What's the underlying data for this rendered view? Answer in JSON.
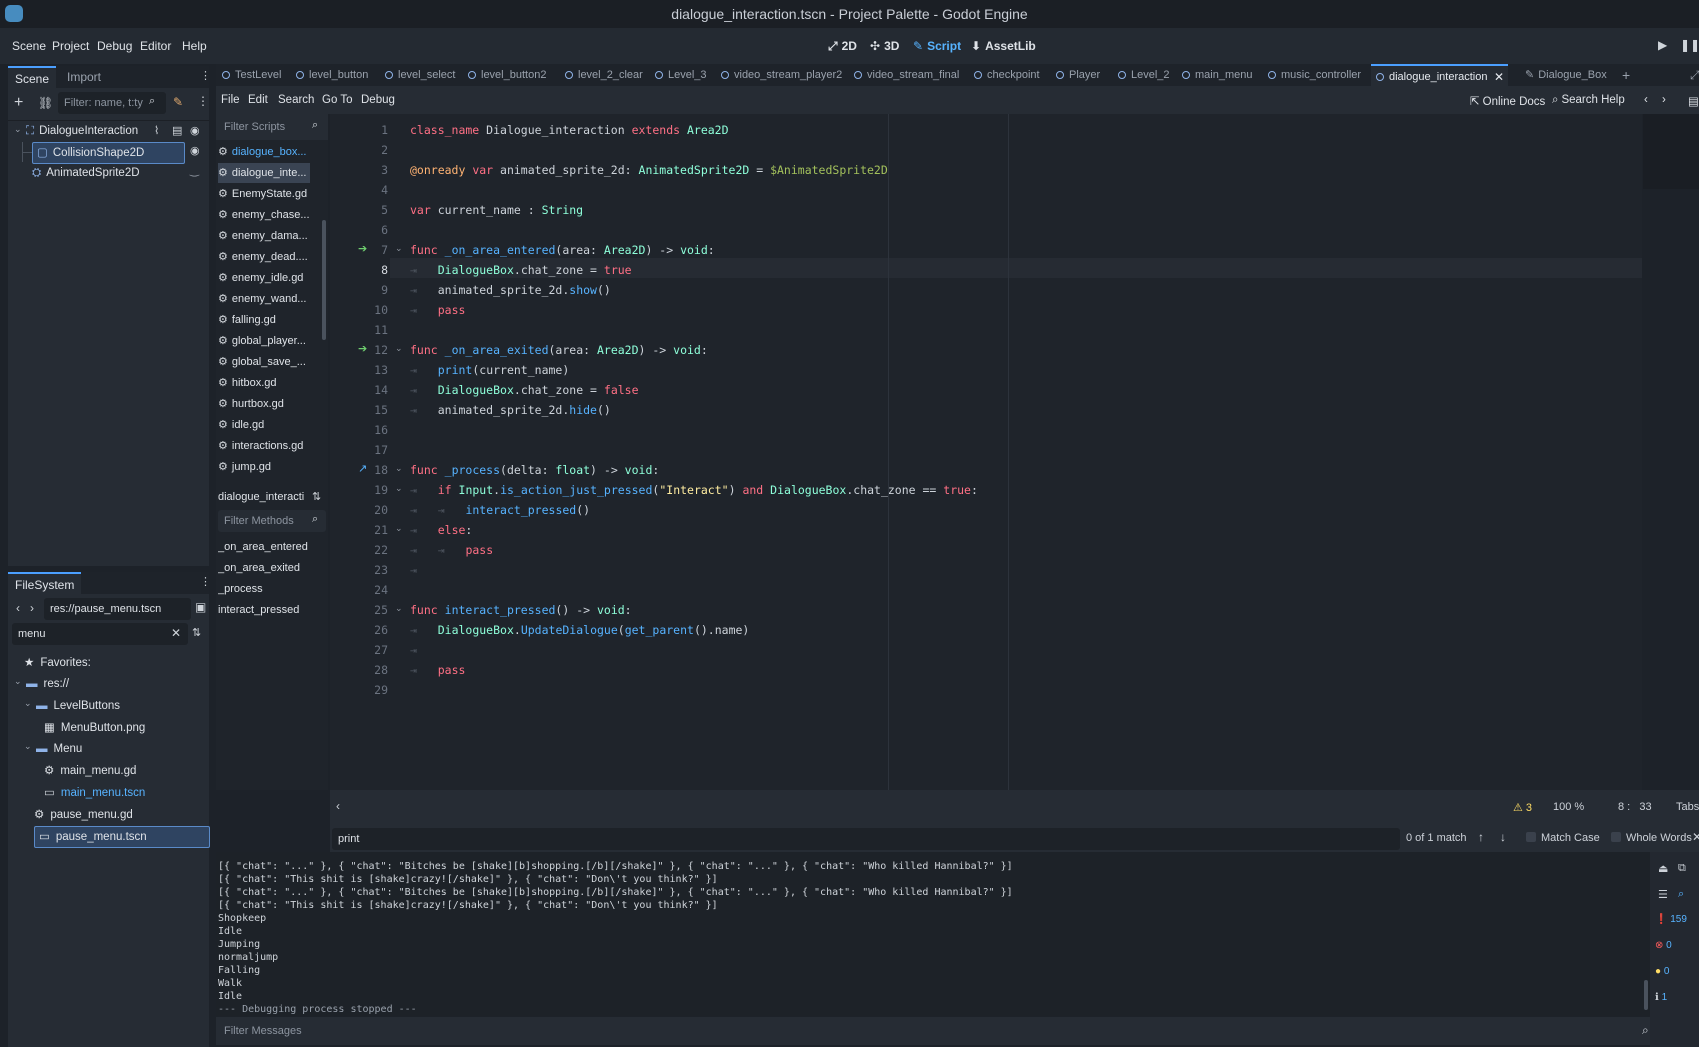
{
  "window": {
    "title": "dialogue_interaction.tscn - Project Palette - Godot Engine"
  },
  "menu": {
    "items": [
      "Scene",
      "Project",
      "Debug",
      "Editor",
      "Help"
    ]
  },
  "workspaces": [
    {
      "icon": "⤢",
      "label": "2D"
    },
    {
      "icon": "✣",
      "label": "3D"
    },
    {
      "icon": "✎",
      "label": "Script"
    },
    {
      "icon": "⬇",
      "label": "AssetLib"
    }
  ],
  "scene_dock": {
    "tabs": [
      "Scene",
      "Import"
    ],
    "filter_placeholder": "Filter: name, t:ty",
    "nodes": [
      "DialogueInteraction",
      "CollisionShape2D",
      "AnimatedSprite2D"
    ]
  },
  "filesystem_dock": {
    "tab": "FileSystem",
    "path": "res://pause_menu.tscn",
    "search": "menu",
    "items": [
      "Favorites:",
      "res://",
      "LevelButtons",
      "MenuButton.png",
      "Menu",
      "main_menu.gd",
      "main_menu.tscn",
      "pause_menu.gd",
      "pause_menu.tscn"
    ]
  },
  "editor_tabs": [
    "TestLevel",
    "level_button",
    "level_select",
    "level_button2",
    "level_2_clear",
    "Level_3",
    "video_stream_player2",
    "video_stream_final",
    "checkpoint",
    "Player",
    "Level_2",
    "main_menu",
    "music_controller",
    "dialogue_interaction",
    "Dialogue_Box"
  ],
  "script_menu": [
    "File",
    "Edit",
    "Search",
    "Go To",
    "Debug"
  ],
  "script_toolbar_right": {
    "online_docs": "Online Docs",
    "search_help": "Search Help"
  },
  "scripts_panel": {
    "filter_placeholder": "Filter Scripts",
    "scripts": [
      "dialogue_box...",
      "dialogue_inte...",
      "EnemyState.gd",
      "enemy_chase...",
      "enemy_dama...",
      "enemy_dead....",
      "enemy_idle.gd",
      "enemy_wand...",
      "falling.gd",
      "global_player...",
      "global_save_...",
      "hitbox.gd",
      "hurtbox.gd",
      "idle.gd",
      "interactions.gd",
      "jump.gd"
    ],
    "current_script": "dialogue_interacti",
    "methods_placeholder": "Filter Methods",
    "methods": [
      "_on_area_entered",
      "_on_area_exited",
      "_process",
      "interact_pressed"
    ]
  },
  "code": {
    "line_numbers": [
      "1",
      "2",
      "3",
      "4",
      "5",
      "6",
      "7",
      "8",
      "9",
      "10",
      "11",
      "12",
      "13",
      "14",
      "15",
      "16",
      "17",
      "18",
      "19",
      "20",
      "21",
      "22",
      "23",
      "24",
      "25",
      "26",
      "27",
      "28",
      "29"
    ],
    "current_line": 8
  },
  "status": {
    "warnings": "3",
    "zoom": "100 %",
    "cursor": "8 :   33",
    "indent": "Tabs"
  },
  "find": {
    "query": "print",
    "matches": "0 of 1 match",
    "match_case": "Match Case",
    "whole_words": "Whole Words"
  },
  "output": {
    "lines": [
      "[{ \"chat\": \"...\" }, { \"chat\": \"Bitches be [shake][b]shopping.[/b][/shake]\" }, { \"chat\": \"...\" }, { \"chat\": \"Who killed Hannibal?\" }]",
      "[{ \"chat\": \"This shit is [shake]crazy![/shake]\" }, { \"chat\": \"Don\\'t you think?\" }]",
      "[{ \"chat\": \"...\" }, { \"chat\": \"Bitches be [shake][b]shopping.[/b][/shake]\" }, { \"chat\": \"...\" }, { \"chat\": \"Who killed Hannibal?\" }]",
      "[{ \"chat\": \"This shit is [shake]crazy![/shake]\" }, { \"chat\": \"Don\\'t you think?\" }]",
      "Shopkeep",
      "Idle",
      "Jumping",
      "normaljump",
      "Falling",
      "Walk",
      "Idle",
      "--- Debugging process stopped ---"
    ],
    "filter_placeholder": "Filter Messages",
    "counts": {
      "messages": "159",
      "errors": "0",
      "warnings": "0",
      "info": "1"
    }
  }
}
